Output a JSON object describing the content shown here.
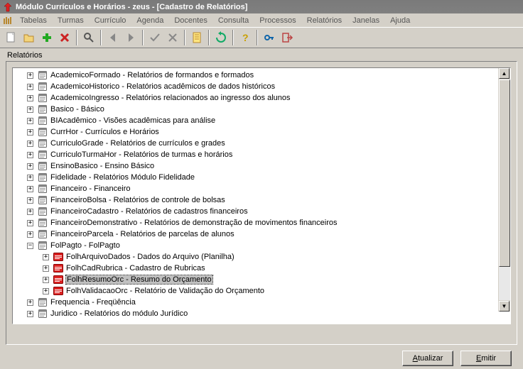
{
  "window": {
    "title": "Módulo Currículos e Horários - zeus - [Cadastro de Relatórios]"
  },
  "menu": {
    "items": [
      "Tabelas",
      "Turmas",
      "Currículo",
      "Agenda",
      "Docentes",
      "Consulta",
      "Processos",
      "Relatórios",
      "Janelas",
      "Ajuda"
    ]
  },
  "panel": {
    "label": "Relatórios"
  },
  "tree": {
    "items": [
      {
        "key": "AcademicoFormado",
        "desc": "Relatórios de formandos e formados"
      },
      {
        "key": "AcademicoHistorico",
        "desc": "Relatórios acadêmicos de dados históricos"
      },
      {
        "key": "AcademicoIngresso",
        "desc": "Relatórios relacionados ao ingresso dos alunos"
      },
      {
        "key": "Basico",
        "desc": "Básico"
      },
      {
        "key": "BIAcadêmico",
        "desc": "Visões acadêmicas para análise"
      },
      {
        "key": "CurrHor",
        "desc": "Currículos e Horários"
      },
      {
        "key": "CurriculoGrade",
        "desc": "Relatórios de currículos e grades"
      },
      {
        "key": "CurriculoTurmaHor",
        "desc": "Relatórios de turmas e horários"
      },
      {
        "key": "EnsinoBasico",
        "desc": "Ensino Básico"
      },
      {
        "key": "Fidelidade",
        "desc": "Relatórios Módulo Fidelidade"
      },
      {
        "key": "Financeiro",
        "desc": "Financeiro"
      },
      {
        "key": "FinanceiroBolsa",
        "desc": "Relatórios de controle de bolsas"
      },
      {
        "key": "FinanceiroCadastro",
        "desc": "Relatórios de cadastros financeiros"
      },
      {
        "key": "FinanceiroDemonstrativo",
        "desc": "Relatórios de demonstração de movimentos financeiros"
      },
      {
        "key": "FinanceiroParcela",
        "desc": "Relatórios de parcelas de alunos"
      },
      {
        "key": "FolPagto",
        "desc": "FolPagto",
        "expanded": true,
        "children": [
          {
            "key": "FolhArquivoDados",
            "desc": "Dados do Arquivo (Planilha)"
          },
          {
            "key": "FolhCadRubrica",
            "desc": "Cadastro de Rubricas"
          },
          {
            "key": "FolhResumoOrc",
            "desc": "Resumo do Orçamento",
            "selected": true
          },
          {
            "key": "FolhValidacaoOrc",
            "desc": "Relatório de Validação do Orçamento"
          }
        ]
      },
      {
        "key": "Frequencia",
        "desc": "Freqüência"
      },
      {
        "key": "Juridico",
        "desc": "Relatórios do módulo Jurídico"
      }
    ]
  },
  "buttons": {
    "update": "Atualizar",
    "emit": "Emitir"
  }
}
